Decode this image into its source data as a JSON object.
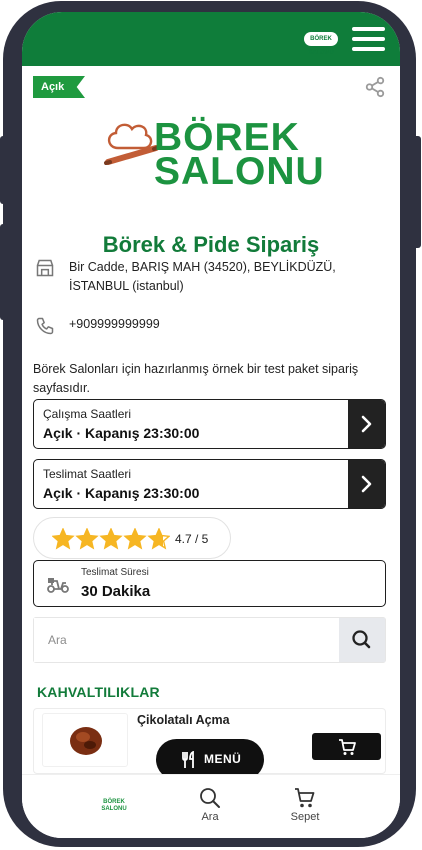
{
  "store": {
    "status": "Açık",
    "brand_line1": "BÖREK",
    "brand_line2": "SALONU",
    "mini_logo": "BÖREK SALONU",
    "title": "Börek & Pide Sipariş",
    "address": "Bir Cadde, BARIŞ MAH (34520), BEYLİKDÜZÜ, İSTANBUL (istanbul)",
    "phone": "+909999999999",
    "description": "Börek Salonları için hazırlanmış örnek bir test paket sipariş sayfasıdır."
  },
  "hours": [
    {
      "label": "Çalışma Saatleri",
      "value": "Açık · Kapanış 23:30:00"
    },
    {
      "label": "Teslimat Saatleri",
      "value": "Açık · Kapanış 23:30:00"
    }
  ],
  "rating": {
    "value": 4.7,
    "text": "4.7 / 5"
  },
  "delivery": {
    "label": "Teslimat Süresi",
    "value": "30 Dakika"
  },
  "search": {
    "placeholder": "Ara"
  },
  "category": {
    "title": "KAHVALTILIKLAR"
  },
  "products": [
    {
      "name": "Çikolatalı Açma"
    }
  ],
  "menu_button": {
    "label": "MENÜ"
  },
  "bottom_nav": [
    {
      "label": "Ara",
      "icon": "search-icon"
    },
    {
      "label": "Sepet",
      "icon": "cart-icon"
    }
  ],
  "colors": {
    "brand_green": "#0f7d3a",
    "status_green": "#1f9a3f",
    "star": "#f6b623",
    "dark": "#111111"
  }
}
